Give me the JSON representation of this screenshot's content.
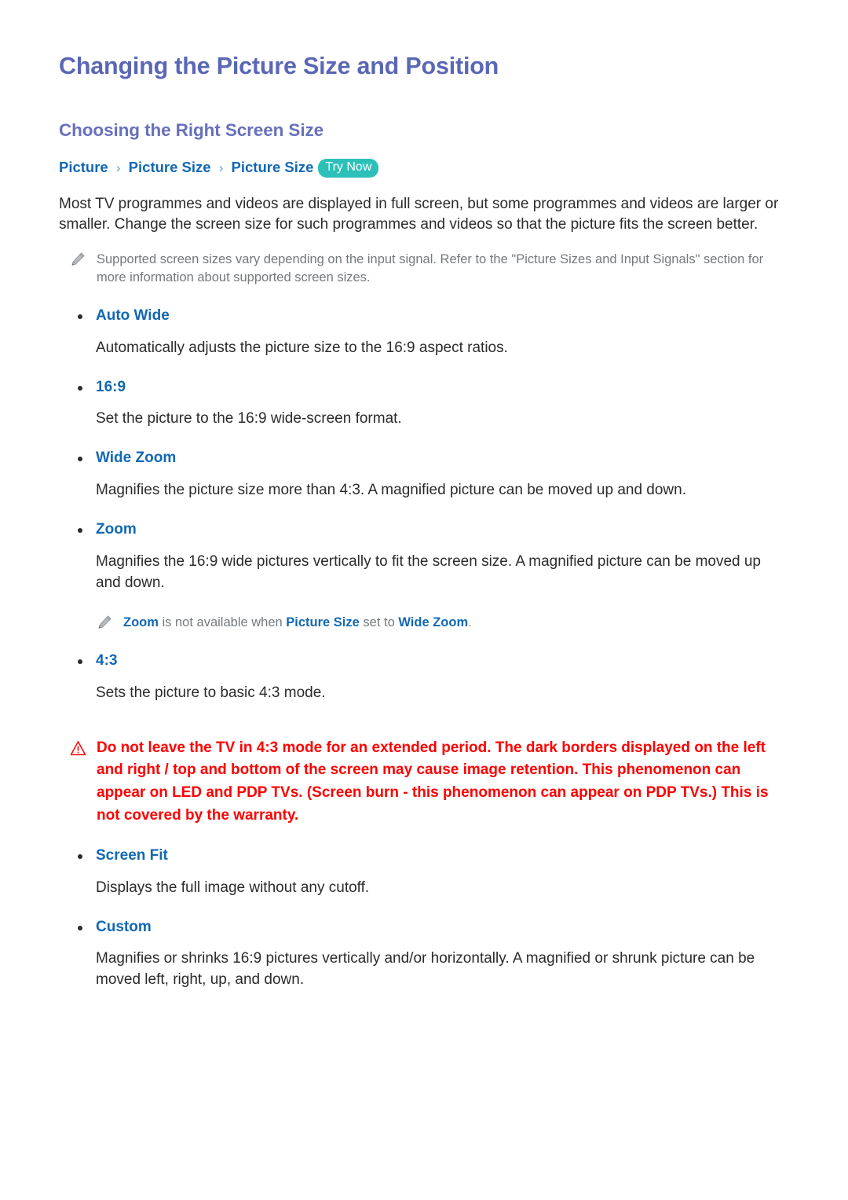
{
  "document": {
    "title": "Changing the Picture Size and Position",
    "section_title": "Choosing the Right Screen Size"
  },
  "breadcrumb": {
    "items": [
      "Picture",
      "Picture Size",
      "Picture Size"
    ],
    "separator": "›",
    "badge": "Try Now"
  },
  "intro": {
    "paragraph": "Most TV programmes and videos are displayed in full screen, but some programmes and videos are larger or smaller. Change the screen size for such programmes and videos so that the picture fits the screen better."
  },
  "notes": {
    "supported_sizes": {
      "icon": "pencil-icon",
      "text": "Supported screen sizes vary depending on the input signal. Refer to the \"Picture Sizes and Input Signals\" section for more information about supported screen sizes."
    },
    "zoom_unavailable": {
      "icon": "pencil-icon",
      "keyword_1": "Zoom",
      "mid_1": " is not available when ",
      "keyword_2": "Picture Size",
      "mid_2": " set to ",
      "keyword_3": "Wide Zoom",
      "tail": "."
    }
  },
  "options_top": [
    {
      "label": "Auto Wide",
      "description": "Automatically adjusts the picture size to the 16:9 aspect ratios."
    },
    {
      "label": "16:9",
      "description": "Set the picture to the 16:9 wide-screen format."
    },
    {
      "label": "Wide Zoom",
      "description": "Magnifies the picture size more than 4:3. A magnified picture can be moved up and down."
    },
    {
      "label": "Zoom",
      "description": "Magnifies the 16:9 wide pictures vertically to fit the screen size. A magnified picture can be moved up and down."
    }
  ],
  "options_mid": [
    {
      "label": "4:3",
      "description": "Sets the picture to basic 4:3 mode."
    }
  ],
  "warning": {
    "icon": "warning-triangle-icon",
    "text": "Do not leave the TV in 4:3 mode for an extended period. The dark borders displayed on the left and right / top and bottom of the screen may cause image retention. This phenomenon can appear on LED and PDP TVs. (Screen burn - this phenomenon can appear on PDP TVs.) This is not covered by the warranty."
  },
  "options_bottom": [
    {
      "label": "Screen Fit",
      "description": "Displays the full image without any cutoff."
    },
    {
      "label": "Custom",
      "description": "Magnifies or shrinks 16:9 pictures vertically and/or horizontally. A magnified or shrunk picture can be moved left, right, up, and down."
    }
  ],
  "colors": {
    "title": "#5a67b5",
    "section_title": "#6670bc",
    "link_blue": "#1268b3",
    "badge_teal": "#2cc0b9",
    "warning_red": "#ff0000",
    "note_grey": "#74797c",
    "body_text": "#2b2b2b"
  }
}
